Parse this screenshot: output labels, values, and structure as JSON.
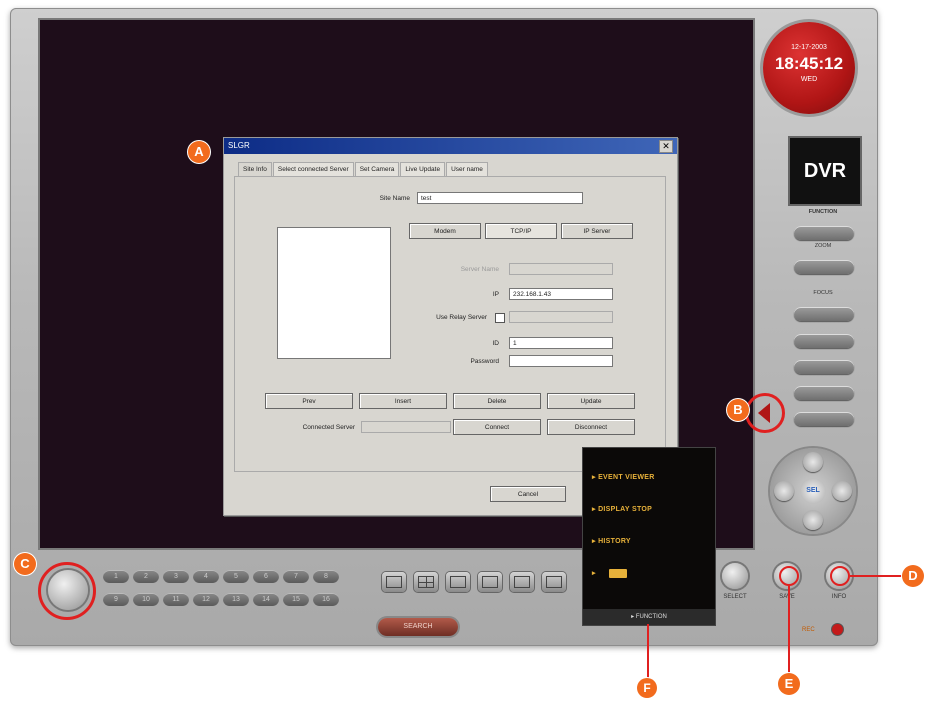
{
  "clock": {
    "date": "12-17-2003",
    "time": "18:45:12",
    "weekday": "WED"
  },
  "brand": {
    "label": "DVR"
  },
  "dialog": {
    "title": "SLGR",
    "tabs": [
      "Site Info",
      "Select connected Server",
      "Set Camera",
      "Live Update",
      "User name"
    ],
    "fields": {
      "site_name": {
        "label": "Site Name",
        "value": "test"
      },
      "server_name": {
        "label": "Server Name",
        "value": ""
      },
      "ip": {
        "label": "IP",
        "value": "232.168.1.43"
      },
      "use_relay": {
        "label": "Use Relay Server",
        "value": ""
      },
      "id": {
        "label": "ID",
        "value": "1"
      },
      "password": {
        "label": "Password",
        "value": ""
      }
    },
    "connection_types": [
      "Modem",
      "TCP/IP",
      "IP Server"
    ],
    "actions": [
      "Prev",
      "Insert",
      "Delete",
      "Update"
    ],
    "connected_server": {
      "label": "Connected Server",
      "value": ""
    },
    "connect_button": "Connect",
    "disconnect_button": "Disconnect",
    "cancel_button": "Cancel"
  },
  "right_panel": {
    "caption_top": "FUNCTION",
    "captions": [
      "ZOOM",
      "FOCUS"
    ]
  },
  "dpad": {
    "center_label": "SEL"
  },
  "round_buttons": [
    "SELECT",
    "SAVE",
    "INFO"
  ],
  "channels_row1": [
    "1",
    "2",
    "3",
    "4",
    "5",
    "6",
    "7",
    "8"
  ],
  "channels_row2": [
    "9",
    "10",
    "11",
    "12",
    "13",
    "14",
    "15",
    "16"
  ],
  "search_label": "SEARCH",
  "popup": {
    "items": [
      "EVENT VIEWER",
      "DISPLAY STOP",
      "HISTORY"
    ],
    "bar_label": "FUNCTION"
  },
  "status": {
    "label": "REC"
  },
  "markers": [
    "A",
    "B",
    "C",
    "D",
    "E",
    "F"
  ]
}
